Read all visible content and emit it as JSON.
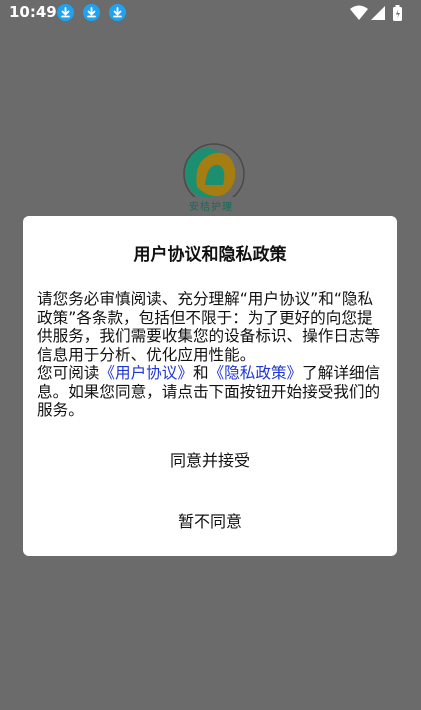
{
  "status_bar": {
    "time": "10:49",
    "notification_icons": [
      "download-icon",
      "download-icon",
      "download-icon"
    ],
    "right_icons": [
      "wifi-icon",
      "signal-icon",
      "battery-icon"
    ],
    "accent_color": "#1fa3f0"
  },
  "app_logo": {
    "text": "安桔护理"
  },
  "dialog": {
    "title": "用户协议和隐私政策",
    "body_p1": "请您务必审慎阅读、充分理解“用户协议”和“隐私政策”各条款，包括但不限于：为了更好的向您提供服务，我们需要收集您的设备标识、操作日志等信息用于分析、优化应用性能。",
    "body_p2_prefix": "您可阅读",
    "link_user_agreement": "《用户协议》",
    "body_p2_and": "和",
    "link_privacy_policy": "《隐私政策》",
    "body_p2_suffix": "了解详细信息。如果您同意，请点击下面按钮开始接受我们的服务。",
    "agree_label": "同意并接受",
    "decline_label": "暂不同意",
    "link_color": "#1f36d6"
  }
}
